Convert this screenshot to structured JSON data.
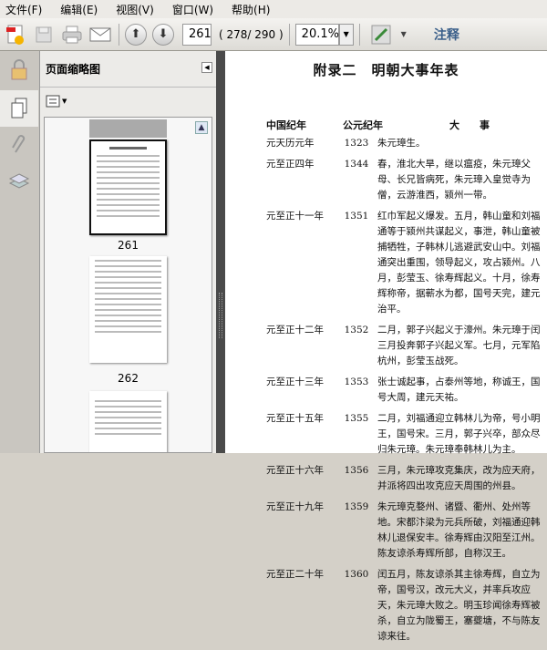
{
  "menu": [
    "文件(F)",
    "编辑(E)",
    "视图(V)",
    "窗口(W)",
    "帮助(H)"
  ],
  "toolbar": {
    "page_input": "261",
    "page_count": "( 278/ 290 )",
    "zoom": "20.1%",
    "comment": "注释"
  },
  "panel": {
    "title": "页面缩略图",
    "thumbnails": [
      "261",
      "262"
    ]
  },
  "document": {
    "title": "附录二　明朝大事年表",
    "headers": [
      "中国纪年",
      "公元纪年",
      "大　　事"
    ],
    "rows": [
      {
        "era": "元天历元年",
        "year": "1323",
        "event": "朱元璋生。"
      },
      {
        "era": "元至正四年",
        "year": "1344",
        "event": "春，淮北大旱，继以瘟疫，朱元璋父母、长兄皆病死，朱元璋入皇觉寺为僧，云游淮西，颍州一带。"
      },
      {
        "era": "元至正十一年",
        "year": "1351",
        "event": "红巾军起义爆发。五月，韩山童和刘福通等于颍州共谋起义，事泄，韩山童被捕牺牲，子韩林儿逃避武安山中。刘福通突出重围，领导起义，攻占颍州。八月，彭莹玉、徐寿辉起义。十月，徐寿辉称帝，据蕲水为都，国号天完，建元治平。"
      },
      {
        "era": "元至正十二年",
        "year": "1352",
        "event": "二月，郭子兴起义于濠州。朱元璋于闰三月投奔郭子兴起义军。七月，元军陷杭州，彭莹玉战死。"
      },
      {
        "era": "元至正十三年",
        "year": "1353",
        "event": "张士诚起事，占泰州等地，称诚王，国号大周，建元天祐。"
      },
      {
        "era": "元至正十五年",
        "year": "1355",
        "event": "二月，刘福通迎立韩林儿为帝，号小明王，国号宋。三月，郭子兴卒，部众尽归朱元璋。朱元璋奉韩林儿为主。"
      },
      {
        "era": "元至正十六年",
        "year": "1356",
        "event": "三月，朱元璋攻克集庆，改为应天府，并派将四出攻克应天周围的州县。"
      },
      {
        "era": "元至正十九年",
        "year": "1359",
        "event": "朱元璋克婺州、诸暨、衢州、处州等地。宋都汴梁为元兵所破，刘福通迎韩林儿退保安丰。徐寿辉由汉阳至江州。陈友谅杀寿辉所部，自称汉王。"
      },
      {
        "era": "元至正二十年",
        "year": "1360",
        "event": "闰五月，陈友谅杀其主徐寿辉，自立为帝，国号汉，改元大义，并率兵攻应天，朱元璋大败之。明玉珍闻徐寿辉被杀，自立为陇蜀王，塞夔塘，不与陈友谅来往。"
      }
    ]
  }
}
